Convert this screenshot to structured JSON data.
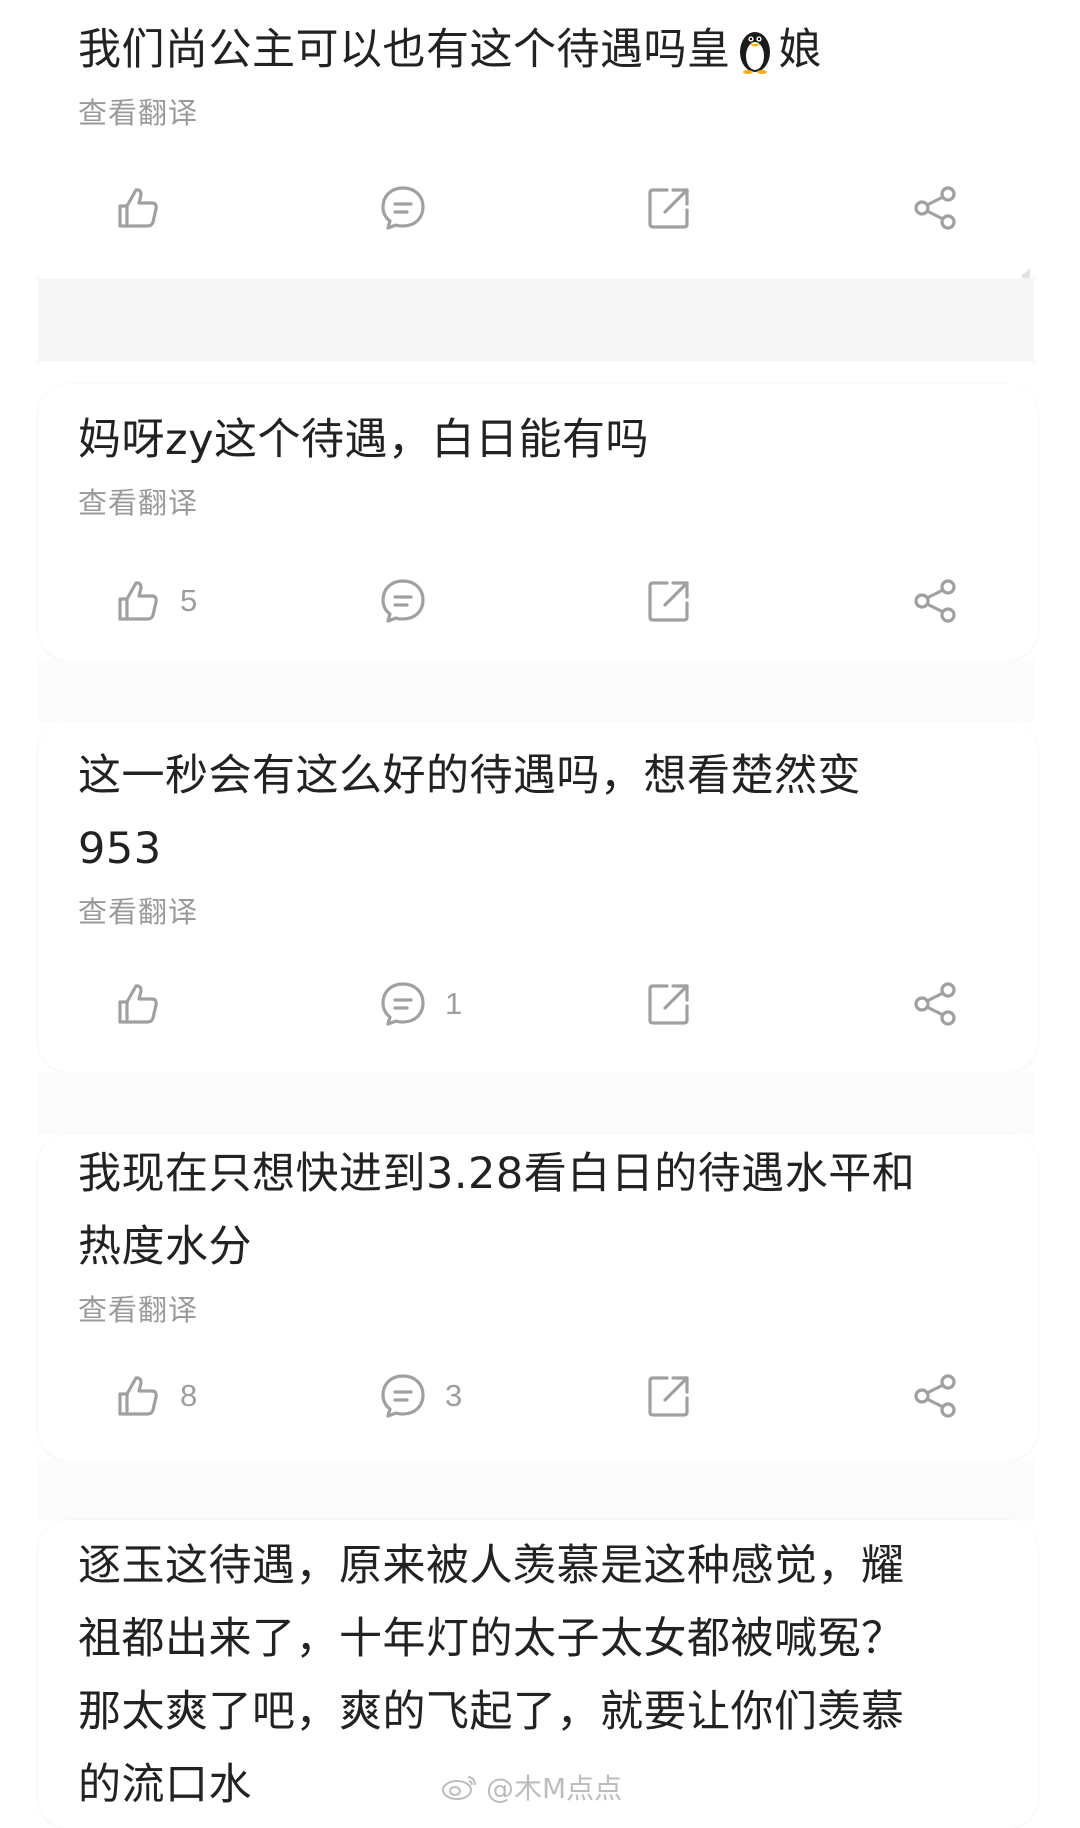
{
  "comments": [
    {
      "text_before_emoji": "我们尚公主可以也有这个待遇吗皇",
      "emoji": "penguin",
      "text_after_emoji": "娘",
      "translate_label": "查看翻译",
      "likes": "",
      "replies": ""
    },
    {
      "text": "妈呀zy这个待遇，白日能有吗",
      "translate_label": "查看翻译",
      "likes": "5",
      "replies": ""
    },
    {
      "text": "这一秒会有这么好的待遇吗，想看楚然变\n953",
      "translate_label": "查看翻译",
      "likes": "",
      "replies": "1"
    },
    {
      "text": "我现在只想快进到3.28看白日的待遇水平和\n热度水分",
      "translate_label": "查看翻译",
      "likes": "8",
      "replies": "3"
    },
    {
      "text": "逐玉这待遇，原来被人羡慕是这种感觉，耀\n祖都出来了，十年灯的太子太女都被喊冤？\n那太爽了吧，爽的飞起了，就要让你们羡慕\n的流口水"
    }
  ],
  "icons": {
    "like": "thumbs-up-icon",
    "comment": "comment-bubble-icon",
    "forward": "forward-square-icon",
    "share": "share-nodes-icon"
  },
  "watermark": {
    "text": "@木M点点",
    "icon": "weibo-logo-icon"
  },
  "colors": {
    "text": "#222222",
    "secondary": "#9a9a9a",
    "icon": "#a0a0a0",
    "background": "#ffffff",
    "separator": "#f6f6f6"
  }
}
